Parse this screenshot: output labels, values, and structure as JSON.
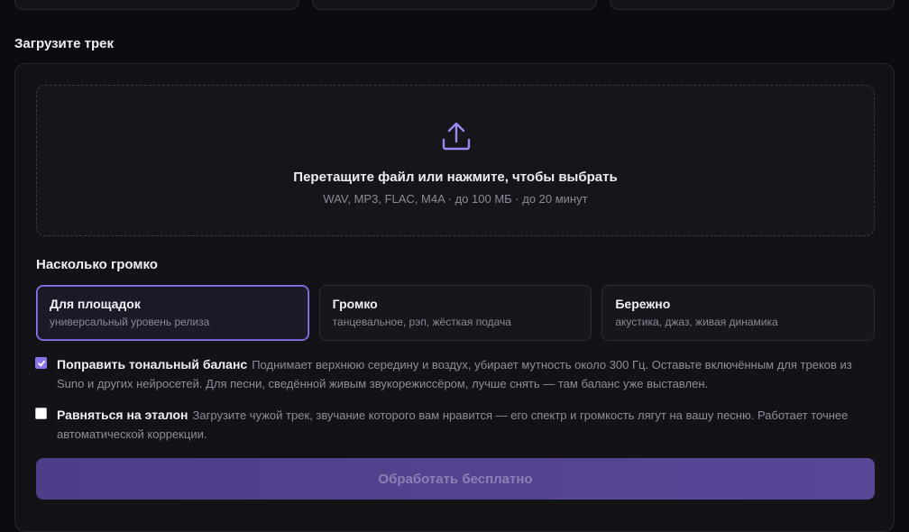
{
  "upload_section": {
    "title": "Загрузите трек",
    "dropzone": {
      "icon": "upload-icon",
      "title": "Перетащите файл или нажмите, чтобы выбрать",
      "subtitle": "WAV, MP3, FLAC, M4A · до 100 МБ · до 20 минут"
    }
  },
  "loudness": {
    "title": "Насколько громко",
    "options": [
      {
        "label": "Для площадок",
        "description": "универсальный уровень релиза",
        "selected": true
      },
      {
        "label": "Громко",
        "description": "танцевальное, рэп, жёсткая подача",
        "selected": false
      },
      {
        "label": "Бережно",
        "description": "акустика, джаз, живая динамика",
        "selected": false
      }
    ]
  },
  "options": {
    "tonal_balance": {
      "checked": true,
      "label": "Поправить тональный баланс",
      "description": "Поднимает верхнюю середину и воздух, убирает мутность около 300 Гц. Оставьте включённым для треков из Suno и других нейросетей. Для песни, сведённой живым звукорежиссёром, лучше снять — там баланс уже выставлен."
    },
    "reference": {
      "checked": false,
      "label": "Равняться на эталон",
      "description": "Загрузите чужой трек, звучание которого вам нравится — его спектр и громкость лягут на вашу песню. Работает точнее автоматической коррекции."
    }
  },
  "submit_label": "Обработать бесплатно",
  "colors": {
    "accent": "#8a74e8",
    "background": "#0c0c10",
    "panel": "#131317"
  }
}
